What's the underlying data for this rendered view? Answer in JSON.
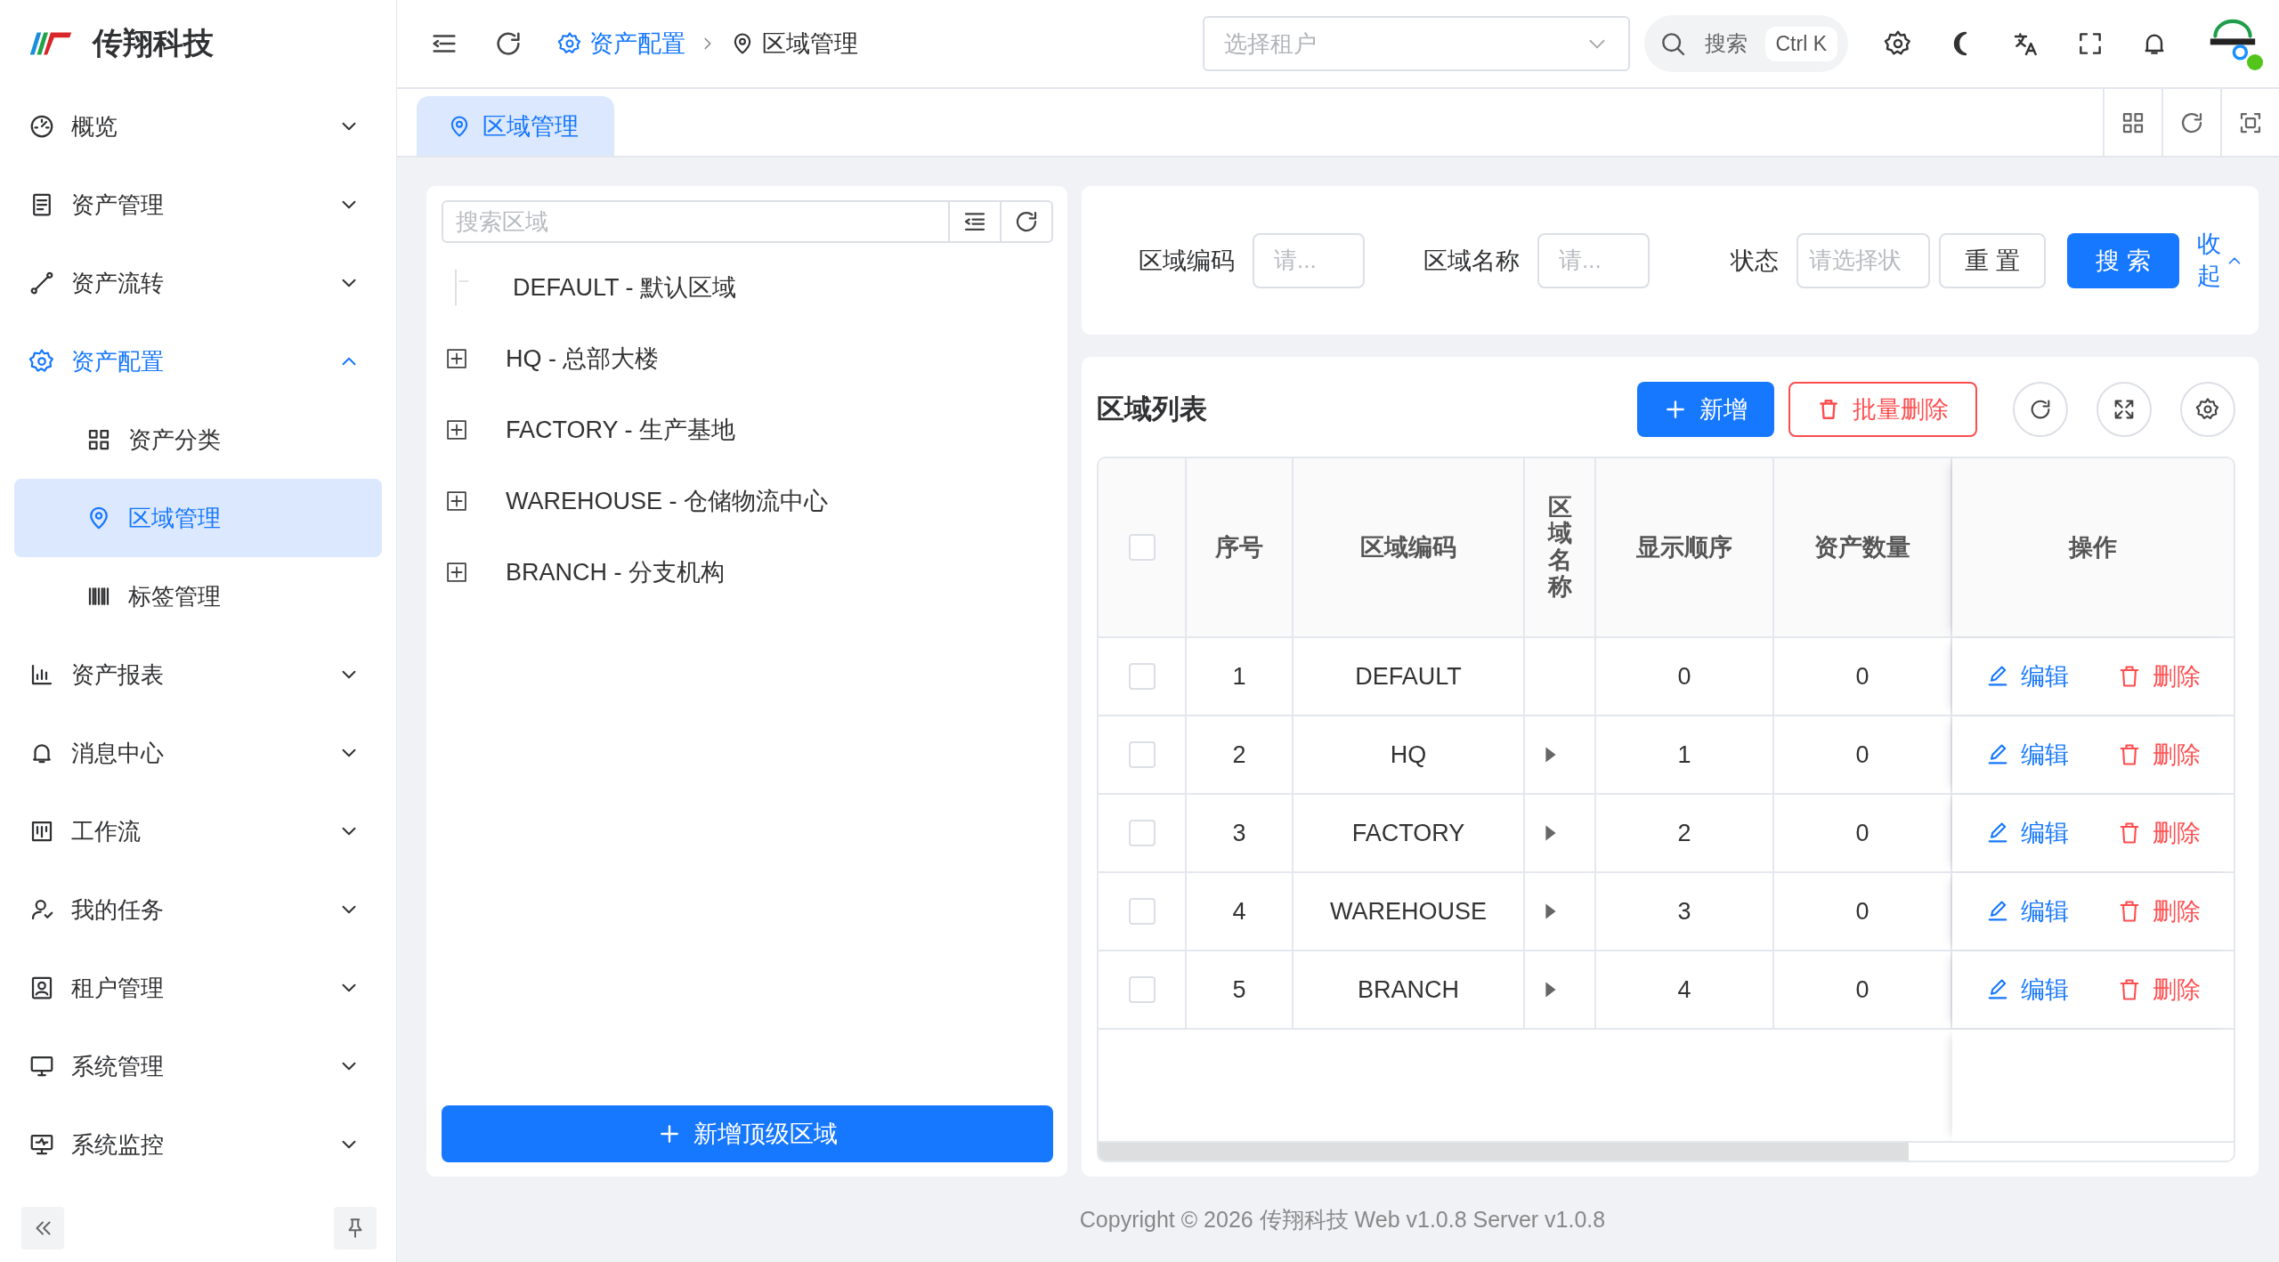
{
  "brand": {
    "name": "传翔科技"
  },
  "sidebar": {
    "items": [
      {
        "label": "概览",
        "selected": false,
        "expanded": false
      },
      {
        "label": "资产管理",
        "selected": false,
        "expanded": false
      },
      {
        "label": "资产流转",
        "selected": false,
        "expanded": false
      },
      {
        "label": "资产配置",
        "selected": true,
        "expanded": true,
        "children": [
          {
            "label": "资产分类",
            "selected": false
          },
          {
            "label": "区域管理",
            "selected": true
          },
          {
            "label": "标签管理",
            "selected": false
          }
        ]
      },
      {
        "label": "资产报表",
        "selected": false,
        "expanded": false
      },
      {
        "label": "消息中心",
        "selected": false,
        "expanded": false
      },
      {
        "label": "工作流",
        "selected": false,
        "expanded": false
      },
      {
        "label": "我的任务",
        "selected": false,
        "expanded": false
      },
      {
        "label": "租户管理",
        "selected": false,
        "expanded": false
      },
      {
        "label": "系统管理",
        "selected": false,
        "expanded": false
      },
      {
        "label": "系统监控",
        "selected": false,
        "expanded": false
      }
    ]
  },
  "header": {
    "breadcrumb": [
      {
        "label": "资产配置",
        "selected": false
      },
      {
        "label": "区域管理",
        "selected": true
      }
    ],
    "tenant_select": {
      "placeholder": "选择租户"
    },
    "search": {
      "label": "搜索",
      "shortcut": "Ctrl K"
    },
    "avatar": {
      "online": true
    }
  },
  "tabs": [
    {
      "label": "区域管理",
      "selected": true
    }
  ],
  "tree": {
    "search_placeholder": "搜索区域",
    "nodes": [
      {
        "label": "DEFAULT - 默认区域",
        "expandable": false
      },
      {
        "label": "HQ - 总部大楼",
        "expandable": true
      },
      {
        "label": "FACTORY - 生产基地",
        "expandable": true
      },
      {
        "label": "WAREHOUSE - 仓储物流中心",
        "expandable": true
      },
      {
        "label": "BRANCH - 分支机构",
        "expandable": true
      }
    ],
    "add_button": "新增顶级区域"
  },
  "filters": {
    "fields": [
      {
        "label": "区域编码",
        "placeholder": "请..."
      },
      {
        "label": "区域名称",
        "placeholder": "请..."
      },
      {
        "label": "状态",
        "placeholder": "请选择状"
      }
    ],
    "reset": "重 置",
    "search": "搜 索",
    "collapse": "收起"
  },
  "table": {
    "title": "区域列表",
    "add": "新增",
    "batch_delete": "批量删除",
    "all_selected": false,
    "columns": [
      "序号",
      "区域编码",
      "区域名称",
      "显示顺序",
      "资产数量",
      "操作"
    ],
    "rows": [
      {
        "index": "1",
        "code": "DEFAULT",
        "expandable": false,
        "order": "0",
        "assets": "0",
        "selected": false,
        "edit": "编辑",
        "delete": "删除"
      },
      {
        "index": "2",
        "code": "HQ",
        "expandable": true,
        "order": "1",
        "assets": "0",
        "selected": false,
        "edit": "编辑",
        "delete": "删除"
      },
      {
        "index": "3",
        "code": "FACTORY",
        "expandable": true,
        "order": "2",
        "assets": "0",
        "selected": false,
        "edit": "编辑",
        "delete": "删除"
      },
      {
        "index": "4",
        "code": "WAREHOUSE",
        "expandable": true,
        "order": "3",
        "assets": "0",
        "selected": false,
        "edit": "编辑",
        "delete": "删除"
      },
      {
        "index": "5",
        "code": "BRANCH",
        "expandable": true,
        "order": "4",
        "assets": "0",
        "selected": false,
        "edit": "编辑",
        "delete": "删除"
      }
    ]
  },
  "footer": "Copyright © 2026 传翔科技 Web v1.0.8 Server v1.0.8"
}
